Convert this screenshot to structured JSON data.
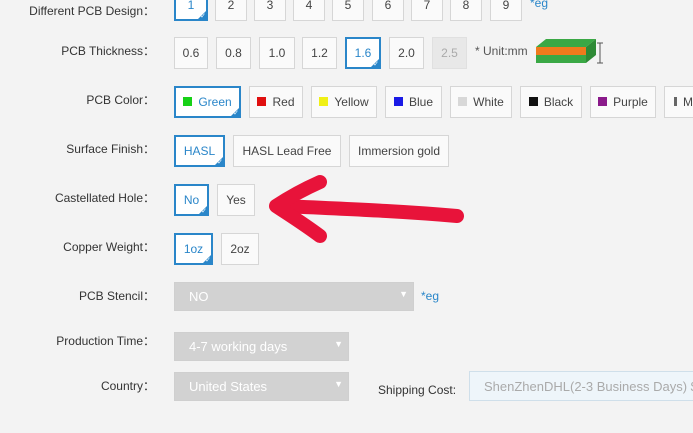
{
  "design": {
    "label": "Different PCB Design：",
    "options": [
      "1",
      "2",
      "3",
      "4",
      "5",
      "6",
      "7",
      "8",
      "9"
    ],
    "selected": "1",
    "note": "*eg"
  },
  "thickness": {
    "label": "PCB Thickness：",
    "options": [
      "0.6",
      "0.8",
      "1.0",
      "1.2",
      "1.6",
      "2.0",
      "2.5"
    ],
    "selected": "1.6",
    "disabled": "2.5",
    "unit_note": "* Unit:mm"
  },
  "color": {
    "label": "PCB Color：",
    "options": [
      {
        "label": "Green",
        "swatch": "#17d117"
      },
      {
        "label": "Red",
        "swatch": "#e01010"
      },
      {
        "label": "Yellow",
        "swatch": "#f0f016"
      },
      {
        "label": "Blue",
        "swatch": "#1a1ae6"
      },
      {
        "label": "White",
        "swatch": "#d8d8d8"
      },
      {
        "label": "Black",
        "swatch": "#111111"
      },
      {
        "label": "Purple",
        "swatch": "#8a1a8a"
      },
      {
        "label": "M",
        "swatch": "#666666"
      }
    ],
    "selected": "Green"
  },
  "finish": {
    "label": "Surface Finish：",
    "options": [
      "HASL",
      "HASL Lead Free",
      "Immersion gold"
    ],
    "selected": "HASL"
  },
  "castellated": {
    "label": "Castellated Hole：",
    "options": [
      "No",
      "Yes"
    ],
    "selected": "No"
  },
  "copper": {
    "label": "Copper Weight：",
    "options": [
      "1oz",
      "2oz"
    ],
    "selected": "1oz"
  },
  "stencil": {
    "label": "PCB Stencil：",
    "value": "NO",
    "note": "*eg"
  },
  "production": {
    "label": "Production Time：",
    "value": "4-7 working days"
  },
  "country": {
    "label": "Country：",
    "value": "United States"
  },
  "shipping": {
    "label": "Shipping Cost:",
    "value": "ShenZhenDHL(2-3 Business Days) $"
  },
  "colors": {
    "accent": "#2a86c9",
    "annotation_arrow": "#e8133a"
  }
}
